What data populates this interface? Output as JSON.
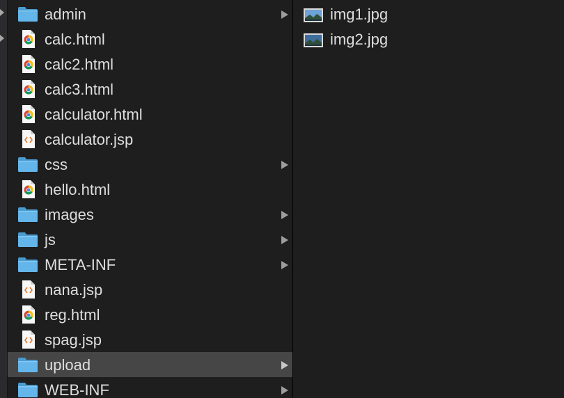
{
  "colors": {
    "background": "#1e1e1e",
    "selected_row": "#464646",
    "folder_blue": "#5fb2e6",
    "text": "#dedede"
  },
  "column1": {
    "items": [
      {
        "name": "admin",
        "type": "folder",
        "icon": "folder-icon",
        "has_children": true
      },
      {
        "name": "calc.html",
        "type": "html",
        "icon": "chrome-html-file-icon",
        "has_children": false
      },
      {
        "name": "calc2.html",
        "type": "html",
        "icon": "chrome-html-file-icon",
        "has_children": false
      },
      {
        "name": "calc3.html",
        "type": "html",
        "icon": "chrome-html-file-icon",
        "has_children": false
      },
      {
        "name": "calculator.html",
        "type": "html",
        "icon": "chrome-html-file-icon",
        "has_children": false
      },
      {
        "name": "calculator.jsp",
        "type": "jsp",
        "icon": "code-file-icon",
        "has_children": false
      },
      {
        "name": "css",
        "type": "folder",
        "icon": "folder-icon",
        "has_children": true
      },
      {
        "name": "hello.html",
        "type": "html",
        "icon": "chrome-html-file-icon",
        "has_children": false
      },
      {
        "name": "images",
        "type": "folder",
        "icon": "folder-icon",
        "has_children": true
      },
      {
        "name": "js",
        "type": "folder",
        "icon": "folder-icon",
        "has_children": true
      },
      {
        "name": "META-INF",
        "type": "folder",
        "icon": "folder-icon",
        "has_children": true
      },
      {
        "name": "nana.jsp",
        "type": "jsp",
        "icon": "code-file-icon",
        "has_children": false
      },
      {
        "name": "reg.html",
        "type": "html",
        "icon": "chrome-html-file-icon",
        "has_children": false
      },
      {
        "name": "spag.jsp",
        "type": "jsp",
        "icon": "code-file-icon",
        "has_children": false
      },
      {
        "name": "upload",
        "type": "folder",
        "icon": "folder-icon",
        "has_children": true,
        "selected": true
      },
      {
        "name": "WEB-INF",
        "type": "folder",
        "icon": "folder-icon",
        "has_children": true
      }
    ]
  },
  "column2": {
    "items": [
      {
        "name": "img1.jpg",
        "type": "image",
        "icon": "image-thumbnail-icon"
      },
      {
        "name": "img2.jpg",
        "type": "image",
        "icon": "image-thumbnail-icon"
      }
    ]
  }
}
